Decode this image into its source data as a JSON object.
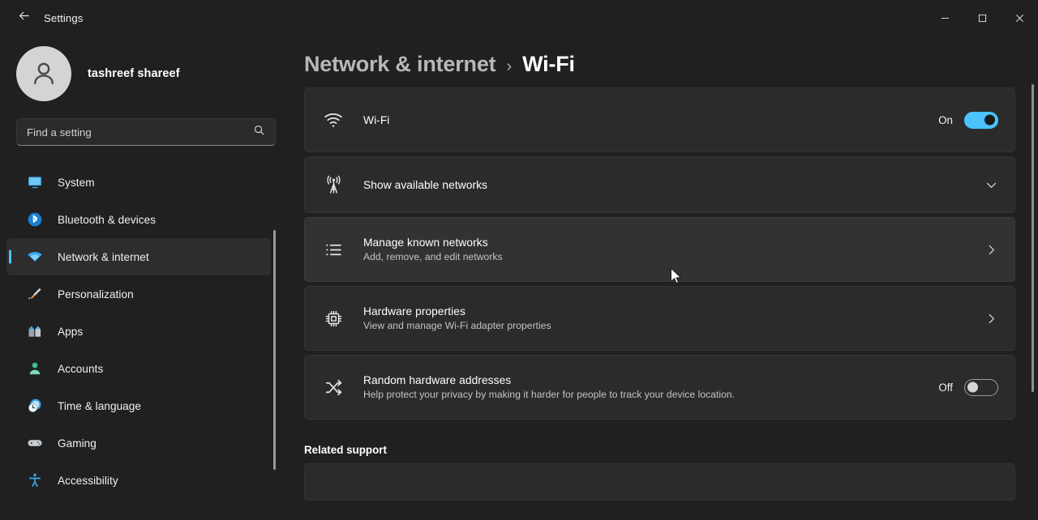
{
  "window": {
    "app_title": "Settings",
    "back_icon": "back-arrow-icon",
    "minimize_label": "−",
    "maximize_label": "□",
    "close_label": "✕"
  },
  "sidebar": {
    "profile": {
      "name": "tashreef shareef",
      "avatar_icon": "user-avatar-icon"
    },
    "search": {
      "placeholder": "Find a setting",
      "value": "",
      "icon": "search-icon"
    },
    "items": [
      {
        "label": "System",
        "icon": "monitor-icon",
        "active": false
      },
      {
        "label": "Bluetooth & devices",
        "icon": "bluetooth-icon",
        "active": false
      },
      {
        "label": "Network & internet",
        "icon": "wifi-icon",
        "active": true
      },
      {
        "label": "Personalization",
        "icon": "paintbrush-icon",
        "active": false
      },
      {
        "label": "Apps",
        "icon": "apps-grid-icon",
        "active": false
      },
      {
        "label": "Accounts",
        "icon": "account-person-icon",
        "active": false
      },
      {
        "label": "Time & language",
        "icon": "clock-globe-icon",
        "active": false
      },
      {
        "label": "Gaming",
        "icon": "gamepad-icon",
        "active": false
      },
      {
        "label": "Accessibility",
        "icon": "accessibility-person-icon",
        "active": false
      }
    ]
  },
  "breadcrumb": {
    "parent": "Network & internet",
    "separator": "›",
    "current": "Wi-Fi"
  },
  "settings": {
    "wifi": {
      "title": "Wi-Fi",
      "icon": "wifi-signal-icon",
      "state_label": "On",
      "toggle_on": true
    },
    "show_networks": {
      "title": "Show available networks",
      "icon": "broadcast-tower-icon",
      "chevron": "chevron-down-icon"
    },
    "manage_networks": {
      "title": "Manage known networks",
      "subtitle": "Add, remove, and edit networks",
      "icon": "list-icon",
      "chevron": "chevron-right-icon",
      "hovered": true
    },
    "hardware_properties": {
      "title": "Hardware properties",
      "subtitle": "View and manage Wi-Fi adapter properties",
      "icon": "chip-icon",
      "chevron": "chevron-right-icon"
    },
    "random_hardware_addresses": {
      "title": "Random hardware addresses",
      "subtitle": "Help protect your privacy by making it harder for people to track your device location.",
      "icon": "shuffle-icon",
      "state_label": "Off",
      "toggle_on": false
    }
  },
  "related_support": {
    "heading": "Related support"
  },
  "colors": {
    "accent": "#4cc2ff",
    "page_bg": "#202020",
    "card_bg": "#2b2b2b",
    "card_hover_bg": "#323232"
  }
}
